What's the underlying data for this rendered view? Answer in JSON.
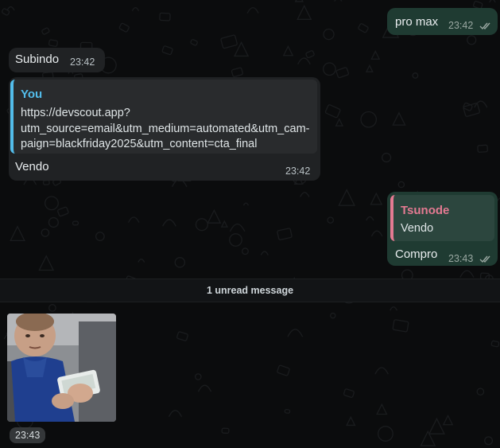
{
  "messages": [
    {
      "direction": "outgoing",
      "text": "pro max",
      "time": "23:42",
      "status": "read"
    },
    {
      "direction": "incoming",
      "text": "Subindo",
      "time": "23:42"
    },
    {
      "direction": "incoming",
      "reply": {
        "author": "You",
        "lines": [
          "https://devscout.app?",
          "utm_source=email&utm_medium=automated&utm_cam-",
          "paign=blackfriday2025&utm_content=cta_final"
        ]
      },
      "text": "Vendo",
      "time": "23:42"
    },
    {
      "direction": "outgoing",
      "reply": {
        "author": "Tsunode",
        "text": "Vendo"
      },
      "text": "Compro",
      "time": "23:43",
      "status": "read"
    }
  ],
  "unread_divider": "1 unread message",
  "photo_message": {
    "time": "23:43"
  },
  "icons": {
    "read_receipt": "double-check-icon"
  },
  "colors": {
    "background": "#0b0c0d",
    "incoming_bubble": "#202224",
    "outgoing_bubble": "#1f3b32",
    "quote_you": "#53bdeb",
    "quote_tsunode": "#e47a92"
  }
}
